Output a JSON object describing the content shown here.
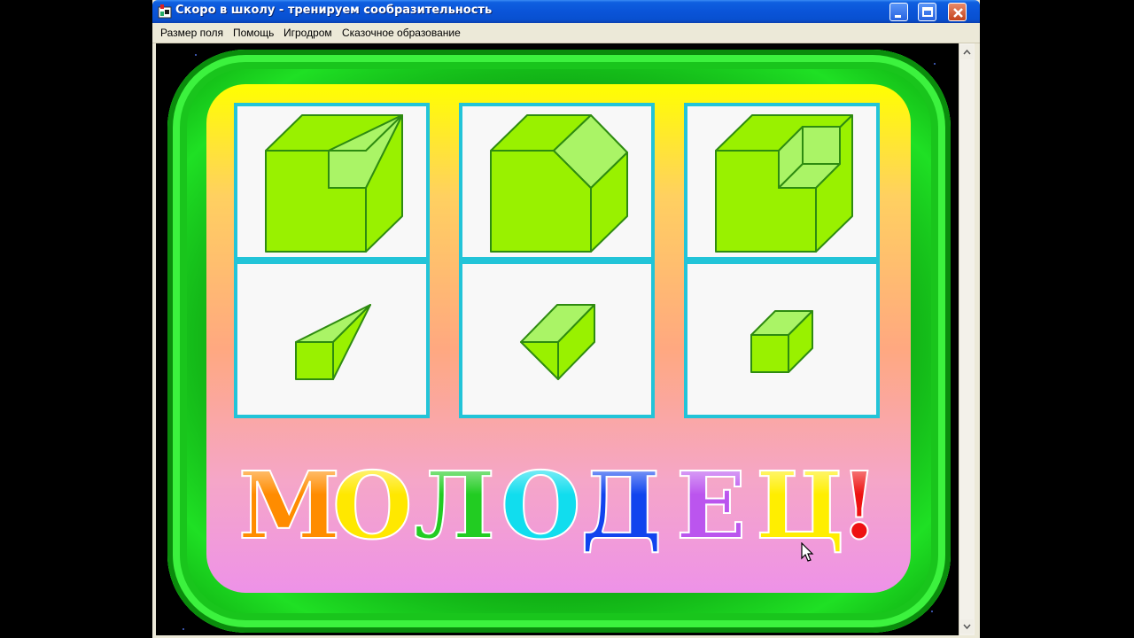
{
  "window": {
    "title": "Скоро в школу - тренируем сообразительность",
    "controls": [
      "minimize",
      "maximize",
      "close"
    ]
  },
  "menu": {
    "items": [
      {
        "label": "Размер поля"
      },
      {
        "label": "Помощь"
      },
      {
        "label": "Игродром"
      },
      {
        "label": "Сказочное образование"
      }
    ]
  },
  "game": {
    "tiles_top": [
      "cube-with-wedge-cut",
      "cube-with-corner-cut",
      "cube-with-box-cut"
    ],
    "tiles_bottom": [
      "wedge-piece",
      "corner-piece",
      "box-piece"
    ],
    "message": {
      "letters": [
        {
          "char": "М",
          "color": "#ff8c00"
        },
        {
          "char": "О",
          "color": "#ffe800"
        },
        {
          "char": "Л",
          "color": "#22cc22"
        },
        {
          "char": "О",
          "color": "#11ddee"
        },
        {
          "char": "Д",
          "color": "#1144ee"
        },
        {
          "char": "Е",
          "color": "#bb55ee"
        },
        {
          "char": "Ц",
          "color": "#ffee00"
        },
        {
          "char": "!",
          "color": "#ee1111"
        }
      ]
    }
  },
  "colors": {
    "cube_face": "#99f100",
    "cube_cut": "#aaf466",
    "cube_edge": "#2e8b10",
    "tile_border": "#22c4d8"
  }
}
